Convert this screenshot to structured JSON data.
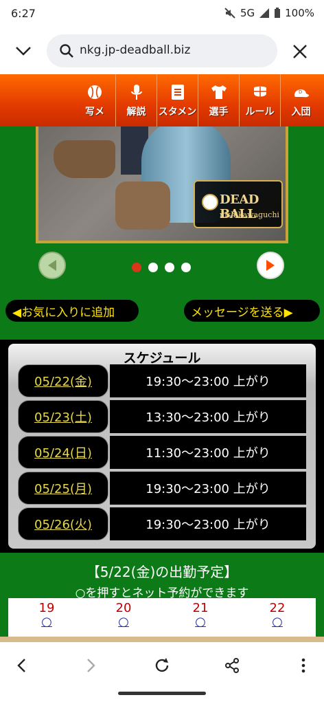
{
  "status": {
    "time": "6:27",
    "network": "5G",
    "battery": "100%"
  },
  "browser": {
    "url": "nkg.jp-deadball.biz"
  },
  "nav": [
    {
      "icon": "baseball-icon",
      "label": "写メ"
    },
    {
      "icon": "microphone-icon",
      "label": "解説"
    },
    {
      "icon": "document-icon",
      "label": "スタメン"
    },
    {
      "icon": "jersey-icon",
      "label": "選手"
    },
    {
      "icon": "catcher-mask-icon",
      "label": "ルール"
    },
    {
      "icon": "cap-icon",
      "label": "入団"
    }
  ],
  "banner": {
    "logo_title": "DEAD BALL",
    "logo_sub": "nishikawaguchi"
  },
  "actions": {
    "favorite": "◀お気に入りに追加",
    "message": "メッセージを送る▶"
  },
  "schedule": {
    "title": "スケジュール",
    "rows": [
      {
        "date": "05/22(金)",
        "time": "19:30〜23:00 上がり"
      },
      {
        "date": "05/23(土)",
        "time": "13:30〜23:00 上がり"
      },
      {
        "date": "05/24(日)",
        "time": "11:30〜23:00 上がり"
      },
      {
        "date": "05/25(月)",
        "time": "19:30〜23:00 上がり"
      },
      {
        "date": "05/26(火)",
        "time": "19:30〜23:00 上がり"
      }
    ]
  },
  "booking": {
    "title": "【5/22(金)の出勤予定】",
    "subtitle": "○を押すとネット予約ができます",
    "slots": [
      {
        "hour": "19",
        "mark": "○"
      },
      {
        "hour": "20",
        "mark": "○"
      },
      {
        "hour": "21",
        "mark": "○"
      },
      {
        "hour": "22",
        "mark": "○"
      }
    ]
  },
  "colors": {
    "nav_orange": "#ff6a00",
    "page_green": "#0d7a18",
    "link_yellow": "#ffe500",
    "hour_red": "#c00000"
  }
}
